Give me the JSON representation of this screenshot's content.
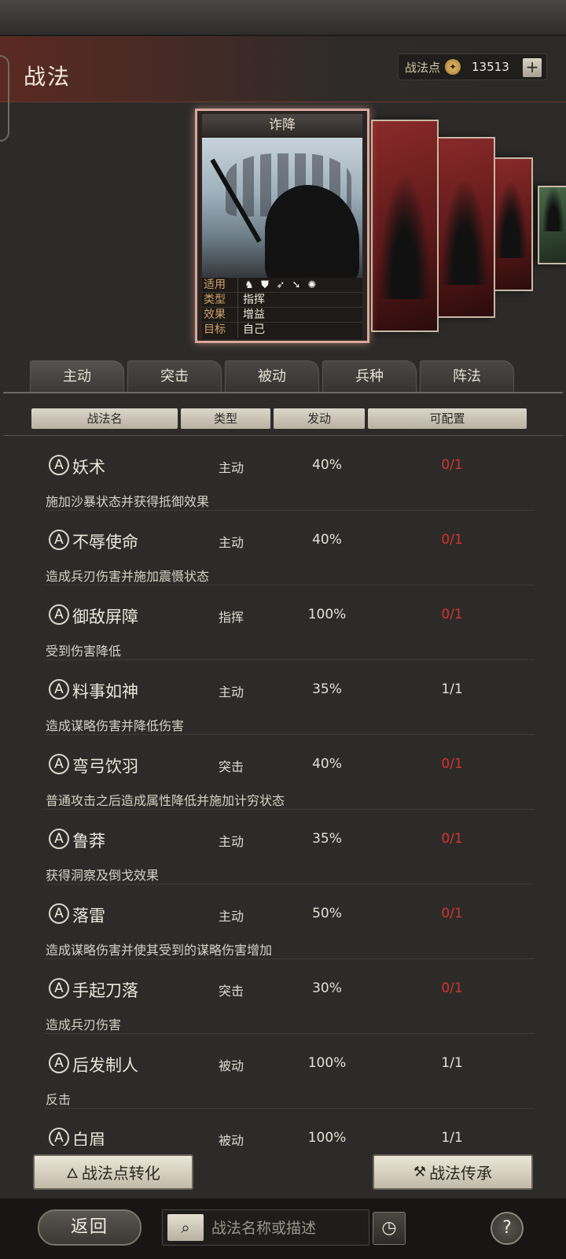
{
  "header": {
    "title": "战法",
    "points_label": "战法点",
    "points_value": "13513",
    "plus_label": "+"
  },
  "card": {
    "name": "诈降",
    "rows": [
      {
        "key": "适用",
        "value": ""
      },
      {
        "key": "类型",
        "value": "指挥"
      },
      {
        "key": "效果",
        "value": "增益"
      },
      {
        "key": "目标",
        "value": "自己"
      }
    ],
    "unit_icons": [
      "cavalry-icon",
      "shield-icon",
      "bow-icon",
      "spear-icon",
      "chariot-icon"
    ]
  },
  "tabs": [
    "主动",
    "突击",
    "被动",
    "兵种",
    "阵法"
  ],
  "columns": [
    "战法名",
    "类型",
    "发动",
    "可配置"
  ],
  "tactics": [
    {
      "grade": "A",
      "name": "妖术",
      "type": "主动",
      "rate": "40%",
      "slots": "0/1",
      "full": true,
      "desc": "施加沙暴状态并获得抵御效果"
    },
    {
      "grade": "A",
      "name": "不辱使命",
      "type": "主动",
      "rate": "40%",
      "slots": "0/1",
      "full": true,
      "desc": "造成兵刃伤害并施加震慑状态"
    },
    {
      "grade": "A",
      "name": "御敌屏障",
      "type": "指挥",
      "rate": "100%",
      "slots": "0/1",
      "full": true,
      "desc": "受到伤害降低"
    },
    {
      "grade": "A",
      "name": "料事如神",
      "type": "主动",
      "rate": "35%",
      "slots": "1/1",
      "full": false,
      "desc": "造成谋略伤害并降低伤害"
    },
    {
      "grade": "A",
      "name": "弯弓饮羽",
      "type": "突击",
      "rate": "40%",
      "slots": "0/1",
      "full": true,
      "desc": "普通攻击之后造成属性降低并施加计穷状态"
    },
    {
      "grade": "A",
      "name": "鲁莽",
      "type": "主动",
      "rate": "35%",
      "slots": "0/1",
      "full": true,
      "desc": "获得洞察及倒戈效果"
    },
    {
      "grade": "A",
      "name": "落雷",
      "type": "主动",
      "rate": "50%",
      "slots": "0/1",
      "full": true,
      "desc": "造成谋略伤害并使其受到的谋略伤害增加"
    },
    {
      "grade": "A",
      "name": "手起刀落",
      "type": "突击",
      "rate": "30%",
      "slots": "0/1",
      "full": true,
      "desc": "造成兵刃伤害"
    },
    {
      "grade": "A",
      "name": "后发制人",
      "type": "被动",
      "rate": "100%",
      "slots": "1/1",
      "full": false,
      "desc": "反击"
    },
    {
      "grade": "A",
      "name": "白眉",
      "type": "被动",
      "rate": "100%",
      "slots": "1/1",
      "full": false,
      "desc": ""
    }
  ],
  "buttons": {
    "convert": "战法点转化",
    "inherit": "战法传承",
    "back": "返回",
    "help": "?"
  },
  "search": {
    "placeholder": "战法名称或描述"
  },
  "colors": {
    "slot_full": "#d6322a",
    "slot_available": "#e6e0d3"
  }
}
